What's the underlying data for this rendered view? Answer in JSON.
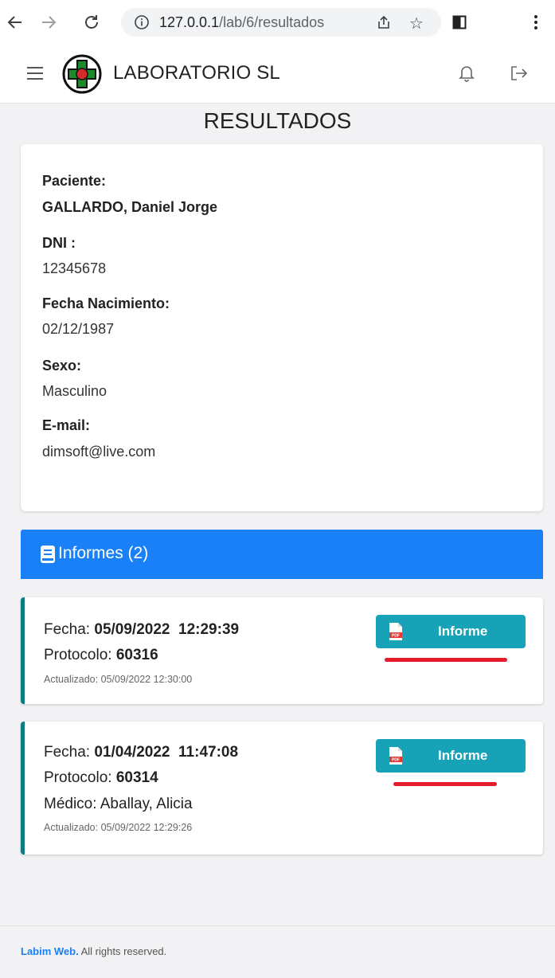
{
  "browser": {
    "url_host": "127.0.0.1",
    "url_path": "/lab/6/resultados"
  },
  "header": {
    "brand": "LABORATORIO SL"
  },
  "page": {
    "title": "RESULTADOS"
  },
  "patient": {
    "label_patient": "Paciente:",
    "name": "GALLARDO, Daniel Jorge",
    "label_dni": "DNI :",
    "dni": "12345678",
    "label_birth": "Fecha Nacimiento:",
    "birth": "02/12/1987",
    "label_sex": "Sexo:",
    "sex": "Masculino",
    "label_email": "E-mail:",
    "email": "dimsoft@live.com"
  },
  "informes": {
    "title": "Informes (2)",
    "items": [
      {
        "fecha_label": "Fecha:",
        "fecha": "05/09/2022",
        "hora": "12:29:39",
        "protocolo_label": "Protocolo:",
        "protocolo": "60316",
        "actualizado": "Actualizado: 05/09/2022 12:30:00",
        "button": "Informe"
      },
      {
        "fecha_label": "Fecha:",
        "fecha": "01/04/2022",
        "hora": "11:47:08",
        "protocolo_label": "Protocolo:",
        "protocolo": "60314",
        "medico": "Médico: Aballay, Alicia",
        "actualizado": "Actualizado: 05/09/2022 12:29:26",
        "button": "Informe"
      }
    ]
  },
  "footer": {
    "brand": "Labim Web.",
    "text": " All rights reserved."
  },
  "colors": {
    "primary": "#1a80f7",
    "info_button": "#17a2b8",
    "report_accent": "#0e7b83",
    "highlight_underline": "#e31b2a"
  },
  "icons": [
    "back-arrow-icon",
    "forward-arrow-icon",
    "reload-icon",
    "info-icon",
    "share-icon",
    "star-icon",
    "sidebar-icon",
    "kebab-menu-icon",
    "hamburger-icon",
    "laboratory-logo-icon",
    "bell-icon",
    "logout-icon",
    "book-icon",
    "pdf-icon"
  ]
}
